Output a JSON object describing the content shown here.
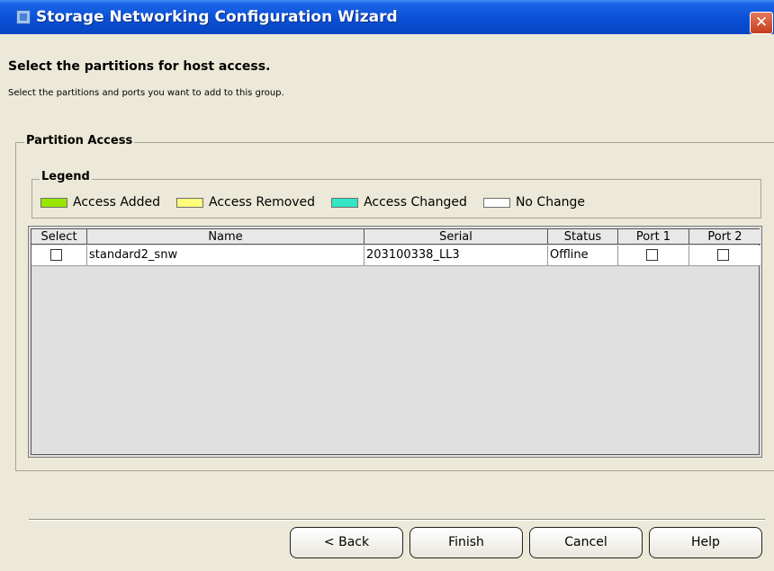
{
  "window": {
    "title": "Storage Networking Configuration Wizard",
    "close_glyph": "✕"
  },
  "header": {
    "heading": "Select the partitions for host access.",
    "subheading": "Select the partitions and ports you want to add to this group."
  },
  "partition_access": {
    "title": "Partition Access",
    "legend": {
      "title": "Legend",
      "items": [
        {
          "label": "Access Added",
          "color": "#99e600"
        },
        {
          "label": "Access Removed",
          "color": "#ffff7a"
        },
        {
          "label": "Access Changed",
          "color": "#33e6c6"
        },
        {
          "label": "No Change",
          "color": "#ffffff"
        }
      ]
    },
    "table": {
      "columns": [
        "Select",
        "Name",
        "Serial",
        "Status",
        "Port 1",
        "Port 2"
      ],
      "rows": [
        {
          "select": false,
          "name": "standard2_snw",
          "serial": "203100338_LL3",
          "status": "Offline",
          "port1": false,
          "port2": false
        }
      ]
    }
  },
  "buttons": {
    "back": "< Back",
    "finish": "Finish",
    "cancel": "Cancel",
    "help": "Help"
  }
}
